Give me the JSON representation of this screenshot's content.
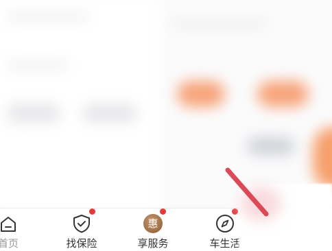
{
  "tabbar": {
    "tabs": [
      {
        "label": "首页",
        "icon": "home-icon",
        "badge_dot": false
      },
      {
        "label": "找保险",
        "icon": "shield-check-icon",
        "badge_dot": true
      },
      {
        "label": "享服务",
        "icon": "hui-badge-icon",
        "badge_text": "惠",
        "badge_dot": true
      },
      {
        "label": "车生活",
        "icon": "compass-icon",
        "badge_dot": true
      }
    ]
  },
  "colors": {
    "accent_red": "#e23a3a",
    "badge_brown": "#a06b42",
    "orange": "#f7a47a",
    "text_dark": "#333333",
    "text_muted": "#9a9a9a"
  }
}
